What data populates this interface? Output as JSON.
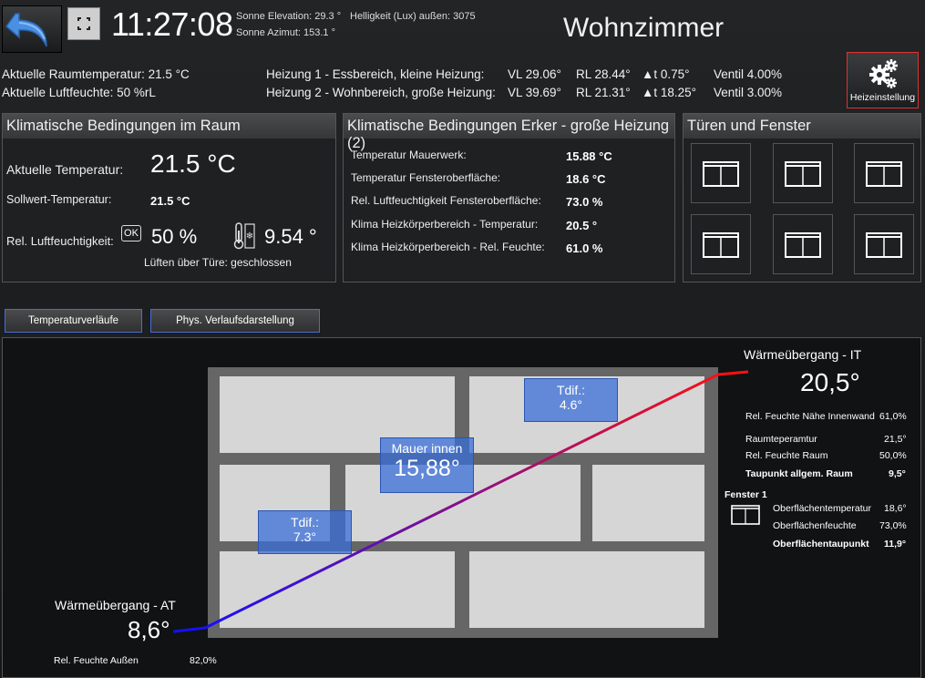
{
  "header": {
    "time": "11:27:08",
    "sun_elevation": "Sonne Elevation: 29.3 °",
    "sun_azimuth": "Sonne Azimut: 153.1 °",
    "brightness": "Helligkeit (Lux) außen: 3075",
    "room_title": "Wohnzimmer"
  },
  "status": {
    "room_temp": "Aktuelle Raumtemperatur: 21.5 °C",
    "room_humidity": "Aktuelle Luftfeuchte: 50 %rL",
    "heating": [
      {
        "name": "Heizung 1 - Essbereich, kleine Heizung:",
        "vl": "VL 29.06°",
        "rl": "RL 28.44°",
        "dt": "t 0.75°",
        "valve": "Ventil 4.00%"
      },
      {
        "name": "Heizung 2 - Wohnbereich, große Heizung:",
        "vl": "VL 39.69°",
        "rl": "RL 21.31°",
        "dt": "t 18.25°",
        "valve": "Ventil 3.00%"
      }
    ],
    "heat_button_label": "Heizeinstellung"
  },
  "panel_room": {
    "title": "Klimatische Bedingungen im Raum",
    "current_temp_label": "Aktuelle Temperatur:",
    "current_temp_value": "21.5 °C",
    "setpoint_label": "Sollwert-Temperatur:",
    "setpoint_value": "21.5 °C",
    "humidity_label": "Rel. Luftfeuchtigkeit:",
    "ok_badge": "OK",
    "humidity_value": "50 %",
    "dewpoint_value": "9.54 °",
    "ventilation": "Lüften über Türe: geschlossen"
  },
  "panel_bay": {
    "title": "Klimatische Bedingungen Erker - große Heizung (2)",
    "rows": [
      {
        "label": "Temperatur Mauerwerk:",
        "value": "15.88 °C"
      },
      {
        "label": "Temperatur Fensteroberfläche:",
        "value": "18.6 °C"
      },
      {
        "label": "Rel. Luftfeuchtigkeit Fensteroberfläche:",
        "value": "73.0 %"
      },
      {
        "label": "Klima Heizkörperbereich - Temperatur:",
        "value": "20.5 °"
      },
      {
        "label": "Klima Heizkörperbereich - Rel. Feuchte:",
        "value": "61.0 %"
      }
    ]
  },
  "panel_doors": {
    "title": "Türen und Fenster"
  },
  "tabs": {
    "temp_curves": "Temperaturverläufe",
    "phys_display": "Phys. Verlaufsdarstellung"
  },
  "diagram": {
    "inner_label": "Wärmeübergang - IT",
    "inner_value": "20,5°",
    "inner_rows": [
      {
        "label": "Rel. Feuchte Nähe Innenwand",
        "value": "61,0%",
        "bold": false
      },
      {
        "label": "Raumteperamtur",
        "value": "21,5°",
        "bold": false
      },
      {
        "label": "Rel. Feuchte Raum",
        "value": "50,0%",
        "bold": false
      },
      {
        "label": "Taupunkt allgem. Raum",
        "value": "9,5°",
        "bold": true
      }
    ],
    "window_title": "Fenster 1",
    "window_rows": [
      {
        "label": "Oberflächentemperatur",
        "value": "18,6°",
        "bold": false
      },
      {
        "label": "Oberflächenfeuchte",
        "value": "73,0%",
        "bold": false
      },
      {
        "label": "Oberflächentaupunkt",
        "value": "11,9°",
        "bold": true
      }
    ],
    "outer_label": "Wärmeübergang - AT",
    "outer_value": "8,6°",
    "outer_humidity_label": "Rel. Feuchte Außen",
    "outer_humidity_value": "82,0%",
    "tdif_top_label": "Tdif.:",
    "tdif_top_value": "4.6°",
    "wall_label": "Mauer innen",
    "wall_value": "15,88°",
    "tdif_bottom_label": "Tdif.:",
    "tdif_bottom_value": "7.3°"
  },
  "colors": {
    "line_start": "#1010ff",
    "line_end": "#ff1010",
    "label_box": "#3a6fd8",
    "heat_button_border": "#dd3333"
  }
}
